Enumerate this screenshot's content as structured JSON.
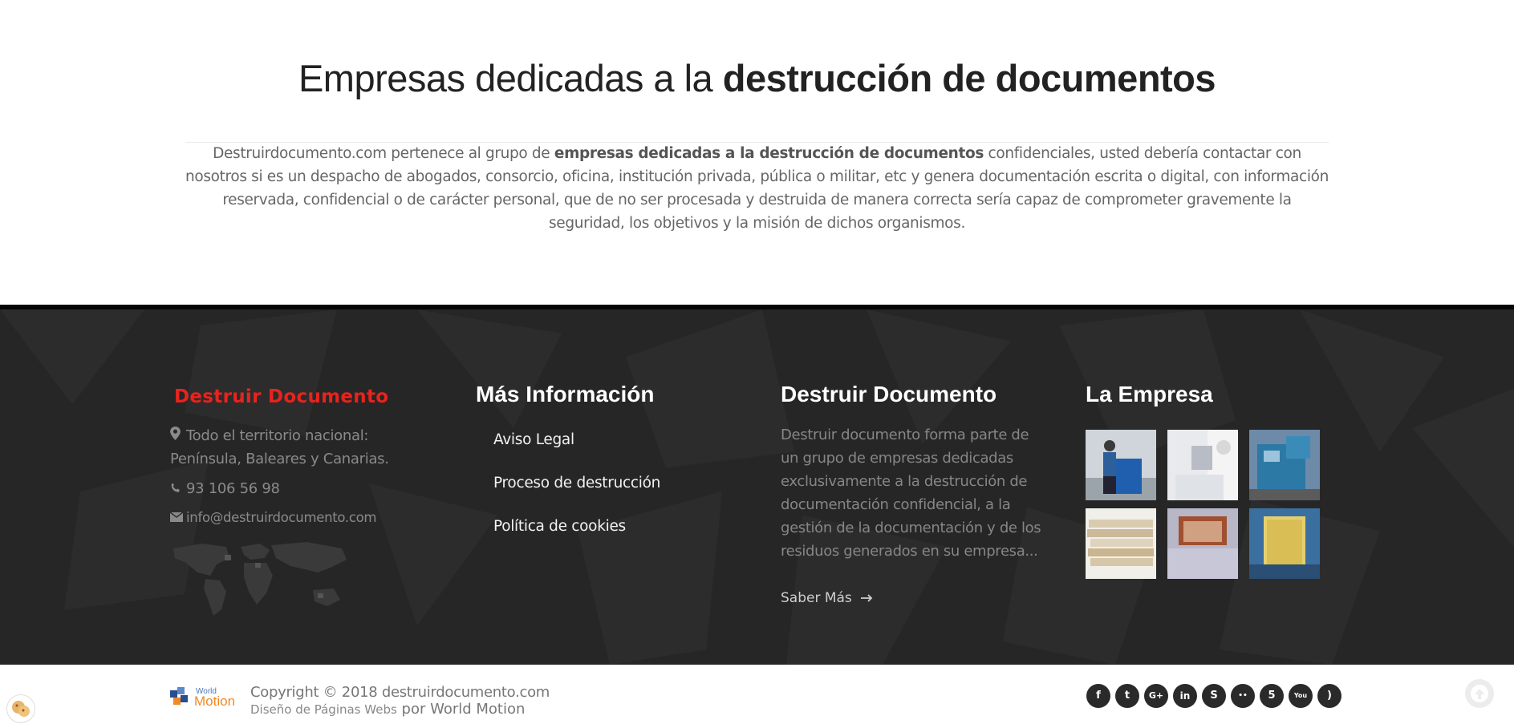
{
  "intro": {
    "title_light": "Empresas dedicadas a la ",
    "title_bold": "destrucción de documentos",
    "text_pre": "Destruirdocumento.com pertenece al grupo de ",
    "text_bold": "empresas dedicadas a la destrucción de documentos",
    "text_post": " confidenciales, usted debería contactar con nosotros si es un despacho de abogados, consorcio, oficina, institución privada, pública o militar,  etc y genera documentación escrita o digital, con información reservada, confidencial o de carácter personal, que de no ser procesada y destruida de manera correcta sería capaz de comprometer gravemente la seguridad, los objetivos y la misión de dichos organismos."
  },
  "footer": {
    "contact": {
      "logo_text": "Destruir Documento",
      "address": "Todo el territorio nacional: Península, Baleares y Canarias.",
      "phone": "93 106 56 98",
      "email": "info@destruirdocumento.com"
    },
    "info": {
      "heading": "Más Información",
      "links": [
        "Aviso Legal",
        "Proceso de destrucción",
        "Política de cookies"
      ]
    },
    "about": {
      "heading": "Destruir Documento",
      "text": "Destruir documento forma parte de un grupo de empresas dedicadas exclusivamente a la destrucción de documentación confidencial, a la gestión de la documentación y de los residuos generados en su empresa...",
      "more_label": "Saber Más"
    },
    "company": {
      "heading": "La Empresa",
      "gallery": [
        "worker-with-bin",
        "shredding-paper",
        "industrial-shredder",
        "paper-stack",
        "truck-shreds",
        "paper-bales"
      ]
    }
  },
  "bottom": {
    "logo_text_top": "World",
    "logo_text_bottom": "Motion",
    "copyright": "Copyright © 2018 destruirdocumento.com",
    "credit_small": "Diseño de Páginas Webs",
    "credit_big": " por World Motion",
    "social": [
      {
        "name": "facebook-icon",
        "glyph": "f"
      },
      {
        "name": "twitter-icon",
        "glyph": "t"
      },
      {
        "name": "google-plus-icon",
        "glyph": "G+"
      },
      {
        "name": "linkedin-icon",
        "glyph": "in"
      },
      {
        "name": "skype-icon",
        "glyph": "S"
      },
      {
        "name": "flickr-icon",
        "glyph": "••"
      },
      {
        "name": "html5-icon",
        "glyph": "5"
      },
      {
        "name": "youtube-icon",
        "glyph": "You"
      },
      {
        "name": "rss-icon",
        "glyph": ")"
      }
    ]
  },
  "colors": {
    "brand_red": "#e8231d",
    "footer_bg": "#262626",
    "footer_border": "#050505"
  }
}
